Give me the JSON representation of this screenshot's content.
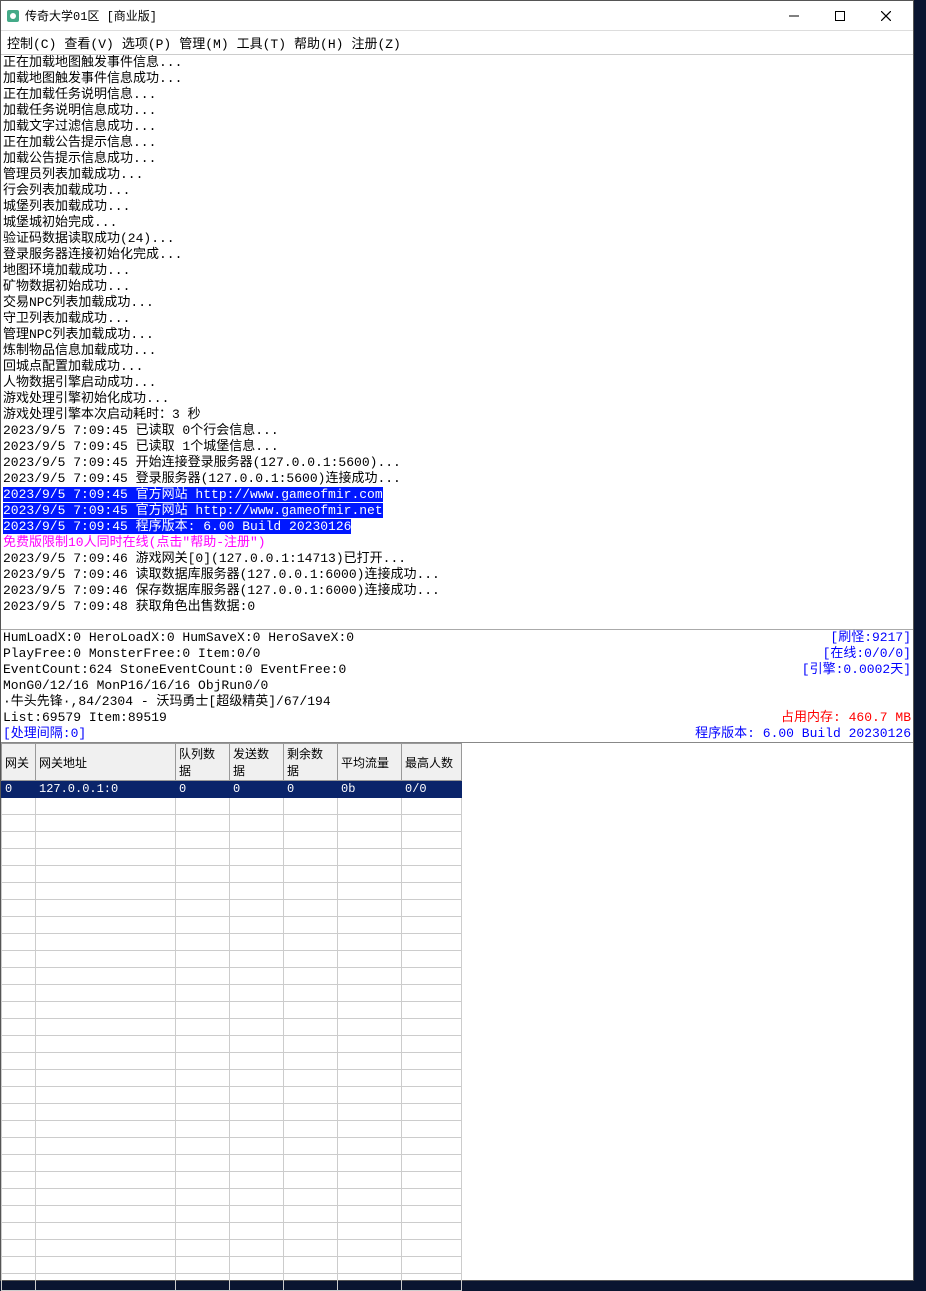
{
  "window": {
    "title": "传奇大学01区 [商业版]"
  },
  "menu": {
    "control": "控制(C)",
    "view": "查看(V)",
    "options": "选项(P)",
    "manage": "管理(M)",
    "tools": "工具(T)",
    "help": "帮助(H)",
    "register": "注册(Z)"
  },
  "log": {
    "lines": [
      "正在加载地图触发事件信息...",
      "加载地图触发事件信息成功...",
      "正在加载任务说明信息...",
      "加载任务说明信息成功...",
      "加载文字过滤信息成功...",
      "正在加载公告提示信息...",
      "加载公告提示信息成功...",
      "管理员列表加载成功...",
      "行会列表加载成功...",
      "城堡列表加载成功...",
      "城堡城初始完成...",
      "验证码数据读取成功(24)...",
      "登录服务器连接初始化完成...",
      "地图环境加载成功...",
      "矿物数据初始成功...",
      "交易NPC列表加载成功...",
      "守卫列表加载成功...",
      "管理NPC列表加载成功...",
      "炼制物品信息加载成功...",
      "回城点配置加载成功...",
      "人物数据引擎启动成功...",
      "游戏处理引擎初始化成功...",
      "游戏处理引擎本次启动耗时：3 秒",
      "2023/9/5 7:09:45 已读取 0个行会信息...",
      "2023/9/5 7:09:45 已读取 1个城堡信息...",
      "2023/9/5 7:09:45 开始连接登录服务器(127.0.0.1:5600)...",
      "2023/9/5 7:09:45 登录服务器(127.0.0.1:5600)连接成功..."
    ],
    "highlight_blue": [
      "2023/9/5 7:09:45 官方网站 http://www.gameofmir.com",
      "2023/9/5 7:09:45 官方网站 http://www.gameofmir.net",
      "2023/9/5 7:09:45 程序版本: 6.00 Build 20230126"
    ],
    "highlight_pink": "免费版限制10人同时在线(点击\"帮助-注册\")",
    "lines_after": [
      "2023/9/5 7:09:46 游戏网关[0](127.0.0.1:14713)已打开...",
      "2023/9/5 7:09:46 读取数据库服务器(127.0.0.1:6000)连接成功...",
      "2023/9/5 7:09:46 保存数据库服务器(127.0.0.1:6000)连接成功...",
      "2023/9/5 7:09:48 获取角色出售数据:0"
    ]
  },
  "stats": {
    "row1_left": "HumLoadX:0 HeroLoadX:0 HumSaveX:0 HeroSaveX:0",
    "row1_right": "[刷怪:9217]",
    "row2_left": "PlayFree:0 MonsterFree:0 Item:0/0",
    "row2_right": "[在线:0/0/0]",
    "row3_left": "EventCount:624 StoneEventCount:0 EventFree:0",
    "row3_right": "[引擎:0.0002天]",
    "row4": "MonG0/12/16 MonP16/16/16 ObjRun0/0",
    "row5": "·牛头先锋·,84/2304 - 沃玛勇士[超级精英]/67/194",
    "row6_left": "List:69579 Item:89519",
    "row6_right": "占用内存: 460.7 MB",
    "row7_left": "[处理间隔:0]",
    "row7_right": "程序版本: 6.00 Build 20230126"
  },
  "table": {
    "headers": [
      "网关",
      "网关地址",
      "队列数据",
      "发送数据",
      "剩余数据",
      "平均流量",
      "最高人数"
    ],
    "row": [
      "0",
      "127.0.0.1:0",
      "0",
      "0",
      "0",
      "0b",
      "0/0"
    ]
  }
}
